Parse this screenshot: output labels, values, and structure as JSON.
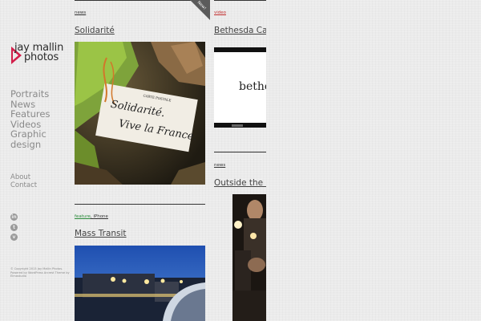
{
  "brand": {
    "line1": "jay mallin",
    "line2": "photos",
    "accent": "#d21e4a"
  },
  "nav": {
    "items": [
      {
        "label": "Portraits"
      },
      {
        "label": "News"
      },
      {
        "label": "Features"
      },
      {
        "label": "Videos"
      },
      {
        "label": "Graphic"
      },
      {
        "label": "design"
      }
    ],
    "secondary": [
      {
        "label": "About"
      },
      {
        "label": "Contact"
      }
    ]
  },
  "social": {
    "icons": [
      "linkedin-icon",
      "twitter-icon",
      "vimeo-icon"
    ]
  },
  "footer": {
    "text": "© Copyright 2013 Jay Mallin Photos. Powered by WordPress Arcrest Theme by Elmastudio"
  },
  "posts": [
    {
      "category": "news",
      "title": "Solidarité",
      "corner": "New!",
      "image_text": "Solidarité.\nVive la France.",
      "card_header": "CARTE POSTALE"
    },
    {
      "category": "feature",
      "category2": "iPhone",
      "title": "Mass Transit"
    },
    {
      "category": "video",
      "title": "Bethesda Care",
      "video_text": "bethe"
    },
    {
      "category": "news",
      "title": "Outside the Fr"
    }
  ]
}
